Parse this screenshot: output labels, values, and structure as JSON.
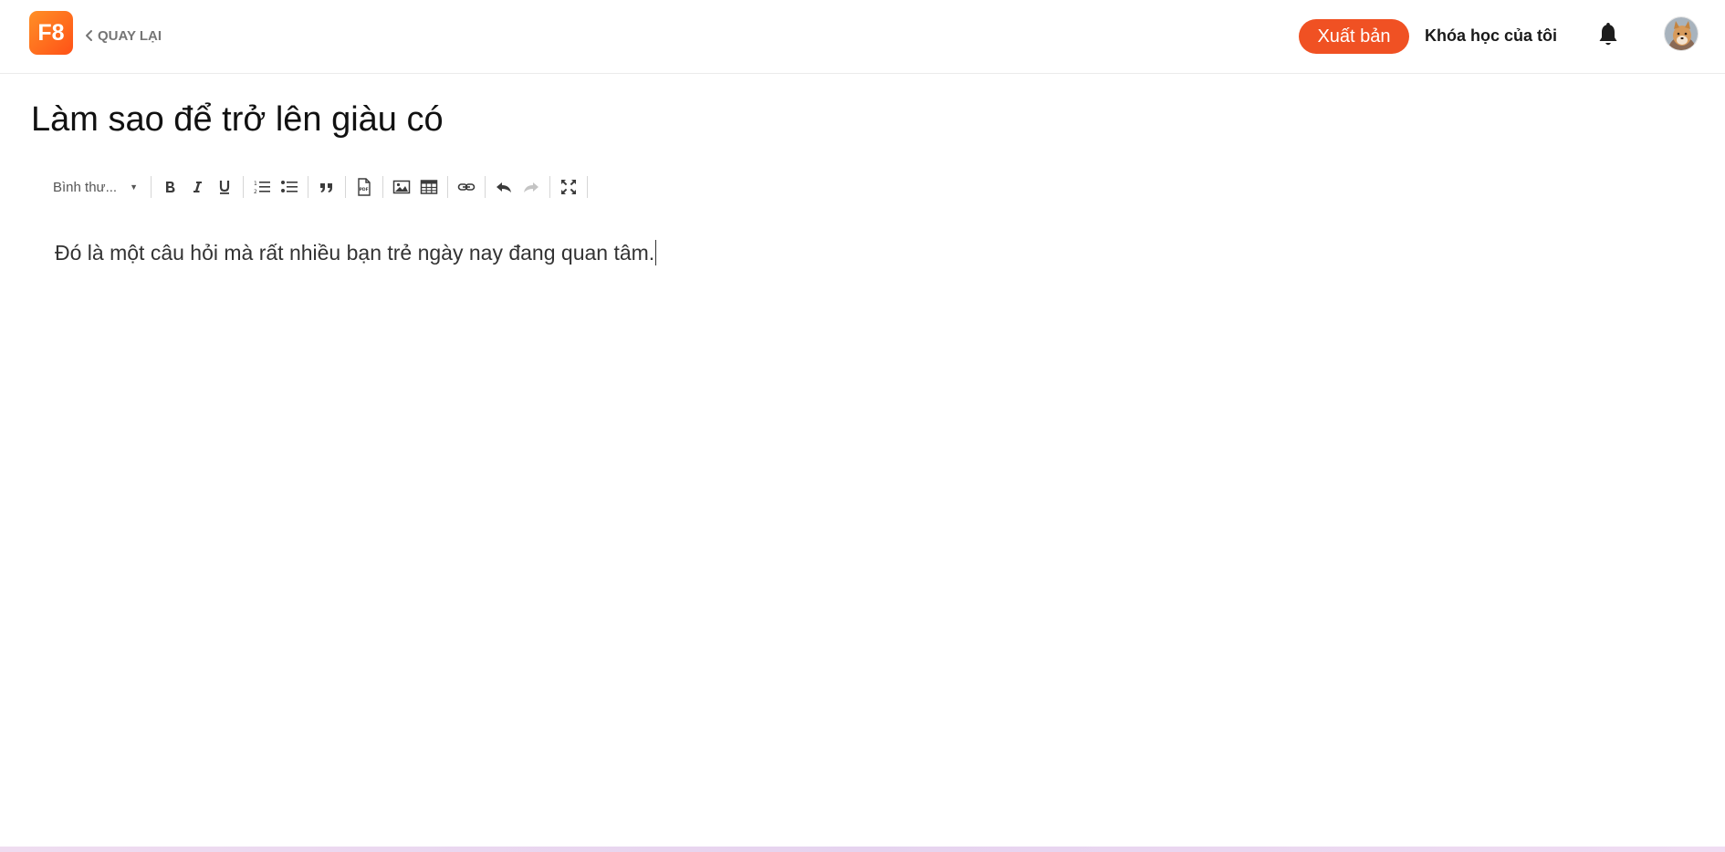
{
  "header": {
    "logo_text": "F8",
    "back_label": "QUAY LẠI",
    "publish_label": "Xuất bản",
    "my_courses_label": "Khóa học của tôi",
    "icons": [
      "bell-icon",
      "avatar"
    ],
    "colors": {
      "brand": "#f05123",
      "logo_gradient_start": "#ff8f26",
      "logo_gradient_end": "#ff5117"
    }
  },
  "post": {
    "title": "Làm sao để trở lên giàu có",
    "body": "Đó là một câu hỏi mà rất nhiều bạn trẻ ngày nay đang quan tâm."
  },
  "toolbar": {
    "format_select": "Bình thư...",
    "buttons": [
      "bold-icon",
      "italic-icon",
      "underline-icon",
      "ordered-list-icon",
      "unordered-list-icon",
      "blockquote-icon",
      "pdf-icon",
      "image-icon",
      "table-icon",
      "link-icon",
      "undo-icon",
      "redo-icon",
      "fullscreen-icon"
    ]
  }
}
